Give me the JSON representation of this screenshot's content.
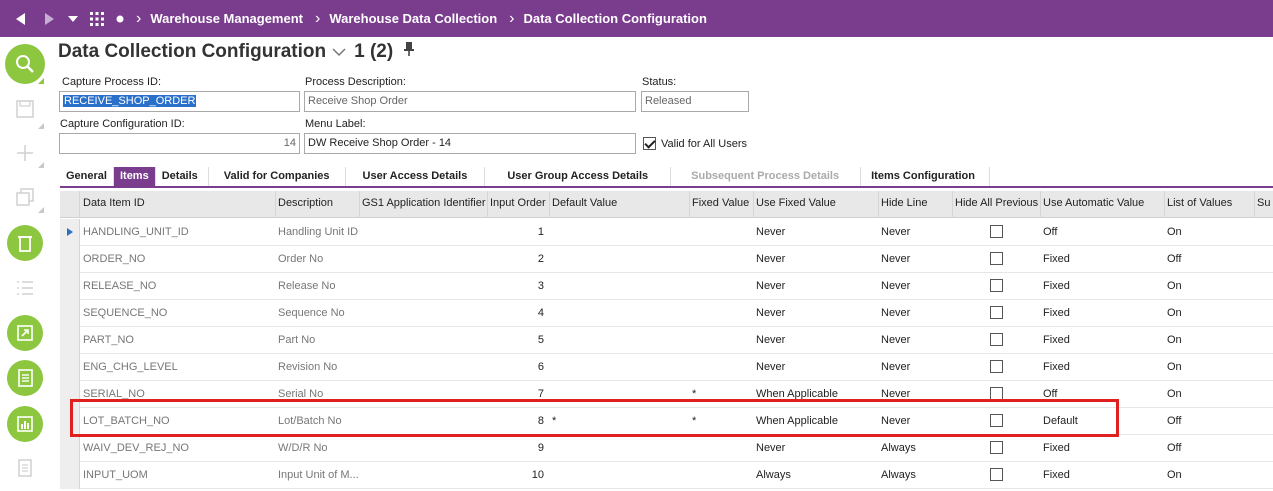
{
  "topbar": {
    "breadcrumbs": [
      "Warehouse Management",
      "Warehouse Data Collection",
      "Data Collection Configuration"
    ],
    "icons": [
      "back-arrow-icon",
      "forward-arrow-icon",
      "dropdown-icon",
      "apps-grid-icon",
      "dot-icon"
    ]
  },
  "page": {
    "title": "Data Collection Configuration",
    "record_counter": "1 (2)"
  },
  "form": {
    "capture_process_id_label": "Capture Process ID:",
    "capture_process_id_value": "RECEIVE_SHOP_ORDER",
    "process_description_label": "Process Description:",
    "process_description_value": "Receive Shop Order",
    "status_label": "Status:",
    "status_value": "Released",
    "capture_configuration_id_label": "Capture Configuration ID:",
    "capture_configuration_id_value": "14",
    "menu_label_label": "Menu Label:",
    "menu_label_value": "DW Receive Shop Order - 14",
    "valid_for_all_users_label": "Valid for All Users",
    "valid_for_all_users": true
  },
  "tabs": [
    {
      "label": "General",
      "state": "normal"
    },
    {
      "label": "Items",
      "state": "active"
    },
    {
      "label": "Details",
      "state": "normal"
    },
    {
      "label": "Valid for Companies",
      "state": "normal"
    },
    {
      "label": "User Access Details",
      "state": "normal"
    },
    {
      "label": "User Group Access Details",
      "state": "normal"
    },
    {
      "label": "Subsequent Process Details",
      "state": "disabled"
    },
    {
      "label": "Items Configuration",
      "state": "normal"
    }
  ],
  "table": {
    "headers": [
      "Data Item ID",
      "Description",
      "GS1 Application Identifier",
      "Input Order",
      "Default Value",
      "Fixed Value",
      "Use Fixed Value",
      "Hide Line",
      "Hide All Previous",
      "Use Automatic Value",
      "List of Values",
      "Su"
    ],
    "rows": [
      {
        "id": "HANDLING_UNIT_ID",
        "desc": "Handling Unit ID",
        "gs1": "",
        "order": "1",
        "default": "",
        "fixed": "",
        "use_fixed": "Never",
        "hide_line": "Never",
        "hide_prev": false,
        "auto": "Off",
        "lov": "On",
        "current": true
      },
      {
        "id": "ORDER_NO",
        "desc": "Order No",
        "gs1": "",
        "order": "2",
        "default": "",
        "fixed": "",
        "use_fixed": "Never",
        "hide_line": "Never",
        "hide_prev": false,
        "auto": "Fixed",
        "lov": "Off"
      },
      {
        "id": "RELEASE_NO",
        "desc": "Release No",
        "gs1": "",
        "order": "3",
        "default": "",
        "fixed": "",
        "use_fixed": "Never",
        "hide_line": "Never",
        "hide_prev": false,
        "auto": "Fixed",
        "lov": "On"
      },
      {
        "id": "SEQUENCE_NO",
        "desc": "Sequence No",
        "gs1": "",
        "order": "4",
        "default": "",
        "fixed": "",
        "use_fixed": "Never",
        "hide_line": "Never",
        "hide_prev": false,
        "auto": "Fixed",
        "lov": "On"
      },
      {
        "id": "PART_NO",
        "desc": "Part No",
        "gs1": "",
        "order": "5",
        "default": "",
        "fixed": "",
        "use_fixed": "Never",
        "hide_line": "Never",
        "hide_prev": false,
        "auto": "Fixed",
        "lov": "On"
      },
      {
        "id": "ENG_CHG_LEVEL",
        "desc": "Revision No",
        "gs1": "",
        "order": "6",
        "default": "",
        "fixed": "",
        "use_fixed": "Never",
        "hide_line": "Never",
        "hide_prev": false,
        "auto": "Fixed",
        "lov": "On"
      },
      {
        "id": "SERIAL_NO",
        "desc": "Serial No",
        "gs1": "",
        "order": "7",
        "default": "",
        "fixed": "*",
        "use_fixed": "When Applicable",
        "hide_line": "Never",
        "hide_prev": false,
        "auto": "Off",
        "lov": "On"
      },
      {
        "id": "LOT_BATCH_NO",
        "desc": "Lot/Batch No",
        "gs1": "",
        "order": "8",
        "default": "*",
        "fixed": "*",
        "use_fixed": "When Applicable",
        "hide_line": "Never",
        "hide_prev": false,
        "auto": "Default",
        "lov": "Off"
      },
      {
        "id": "WAIV_DEV_REJ_NO",
        "desc": "W/D/R No",
        "gs1": "",
        "order": "9",
        "default": "",
        "fixed": "",
        "use_fixed": "Never",
        "hide_line": "Always",
        "hide_prev": false,
        "auto": "Fixed",
        "lov": "Off"
      },
      {
        "id": "INPUT_UOM",
        "desc": "Input Unit of M...",
        "gs1": "",
        "order": "10",
        "default": "",
        "fixed": "",
        "use_fixed": "Always",
        "hide_line": "Always",
        "hide_prev": false,
        "auto": "Fixed",
        "lov": "On"
      }
    ]
  },
  "colors": {
    "brand": "#7a3d8e",
    "accent": "#8dc63f",
    "highlight": "#e0201f",
    "selection": "#2a6fc9"
  }
}
